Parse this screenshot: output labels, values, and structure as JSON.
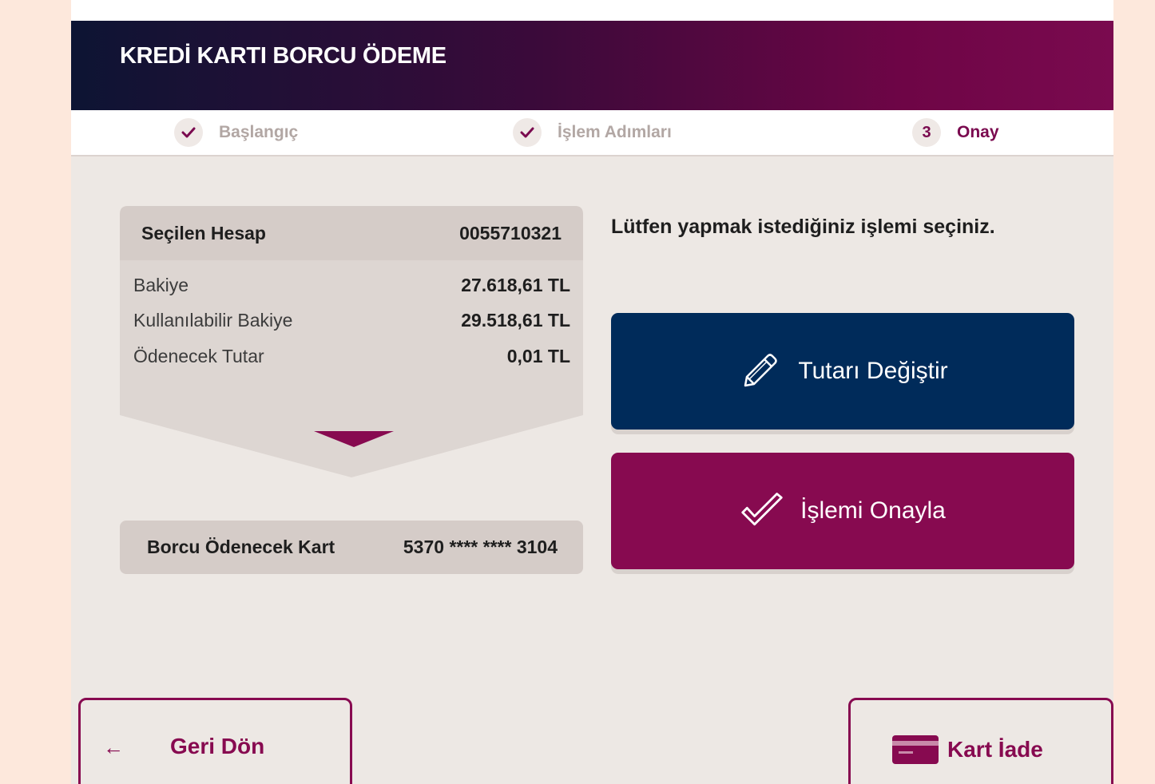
{
  "header": {
    "title": "KREDİ KARTI BORCU ÖDEME"
  },
  "stepper": {
    "steps": [
      {
        "label": "Başlangıç",
        "badge": "",
        "state": "done"
      },
      {
        "label": "İşlem Adımları",
        "badge": "",
        "state": "done"
      },
      {
        "label": "Onay",
        "badge": "3",
        "state": "active"
      }
    ]
  },
  "account": {
    "title": "Seçilen Hesap",
    "number": "0055710321",
    "rows": [
      {
        "label": "Bakiye",
        "value": "27.618,61 TL"
      },
      {
        "label": "Kullanılabilir Bakiye",
        "value": "29.518,61 TL"
      },
      {
        "label": "Ödenecek Tutar",
        "value": "0,01 TL"
      }
    ]
  },
  "target": {
    "label": "Borcu Ödenecek Kart",
    "value": "5370 **** **** 3104"
  },
  "instruction": "Lütfen yapmak istediğiniz işlemi seçiniz.",
  "actions": {
    "change_amount": "Tutarı Değiştir",
    "confirm": "İşlemi Onayla"
  },
  "nav": {
    "back": "Geri Dön",
    "back_arrow": "←",
    "card_return": "Kart İade"
  },
  "colors": {
    "brand_purple": "#870a50",
    "brand_navy": "#002b5a",
    "background": "#ede8e4",
    "outer": "#fde8dc"
  },
  "icons": {
    "done_step": "check-icon",
    "change_amount": "pencil-icon",
    "confirm": "checkmark-icon",
    "card_return": "credit-card-icon"
  }
}
